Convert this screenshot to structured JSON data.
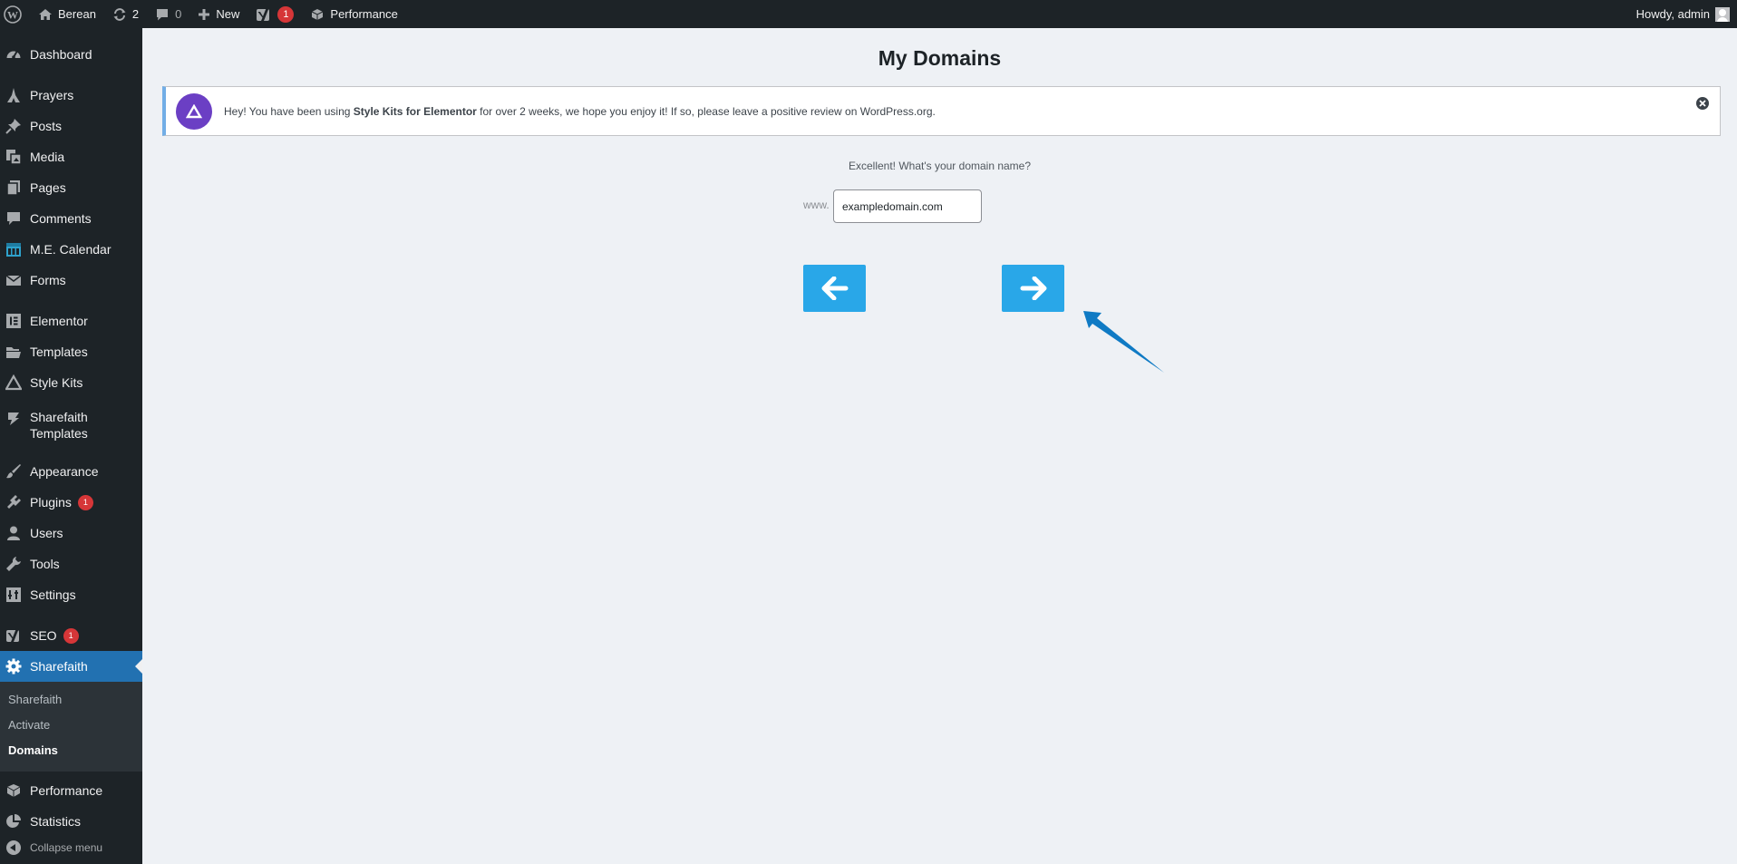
{
  "admin_bar": {
    "site_name": "Berean",
    "updates_count": "2",
    "comments_count": "0",
    "new_label": "New",
    "seo_badge": "1",
    "performance_label": "Performance",
    "greeting": "Howdy, admin"
  },
  "sidebar": {
    "items": [
      {
        "label": "Dashboard",
        "icon": "dashboard-icon"
      },
      {
        "label": "Prayers",
        "icon": "prayers-icon"
      },
      {
        "label": "Posts",
        "icon": "pin-icon"
      },
      {
        "label": "Media",
        "icon": "media-icon"
      },
      {
        "label": "Pages",
        "icon": "pages-icon"
      },
      {
        "label": "Comments",
        "icon": "comment-icon"
      },
      {
        "label": "M.E. Calendar",
        "icon": "calendar-icon"
      },
      {
        "label": "Forms",
        "icon": "envelope-icon"
      },
      {
        "label": "Elementor",
        "icon": "elementor-icon"
      },
      {
        "label": "Templates",
        "icon": "folder-icon"
      },
      {
        "label": "Style Kits",
        "icon": "triangle-icon"
      },
      {
        "label": "Sharefaith Templates",
        "icon": "sharefaith-templates-icon"
      },
      {
        "label": "Appearance",
        "icon": "brush-icon"
      },
      {
        "label": "Plugins",
        "icon": "plugin-icon",
        "badge": "1"
      },
      {
        "label": "Users",
        "icon": "user-icon"
      },
      {
        "label": "Tools",
        "icon": "wrench-icon"
      },
      {
        "label": "Settings",
        "icon": "settings-icon"
      },
      {
        "label": "SEO",
        "icon": "yoast-icon",
        "badge": "1"
      },
      {
        "label": "Sharefaith",
        "icon": "gear-icon",
        "current": true
      },
      {
        "label": "Performance",
        "icon": "performance-icon"
      },
      {
        "label": "Statistics",
        "icon": "pie-chart-icon"
      }
    ],
    "submenu": [
      {
        "label": "Sharefaith"
      },
      {
        "label": "Activate"
      },
      {
        "label": "Domains",
        "active": true
      }
    ],
    "collapse_label": "Collapse menu"
  },
  "main": {
    "title": "My Domains",
    "notice": {
      "prefix": "Hey! You have been using ",
      "product": "Style Kits for Elementor",
      "suffix": " for over 2 weeks, we hope you enjoy it! If so, please leave a positive review on WordPress.org."
    },
    "question": "Excellent! What's your domain name?",
    "www_prefix": "www.",
    "domain_value": "exampledomain.com"
  },
  "colors": {
    "admin_bar_bg": "#1d2327",
    "accent": "#2271b1",
    "nav_button": "#29a7e8",
    "annotation_arrow": "#0f7ac4",
    "badge": "#d63638",
    "notice_logo": "#6b3fc4"
  }
}
